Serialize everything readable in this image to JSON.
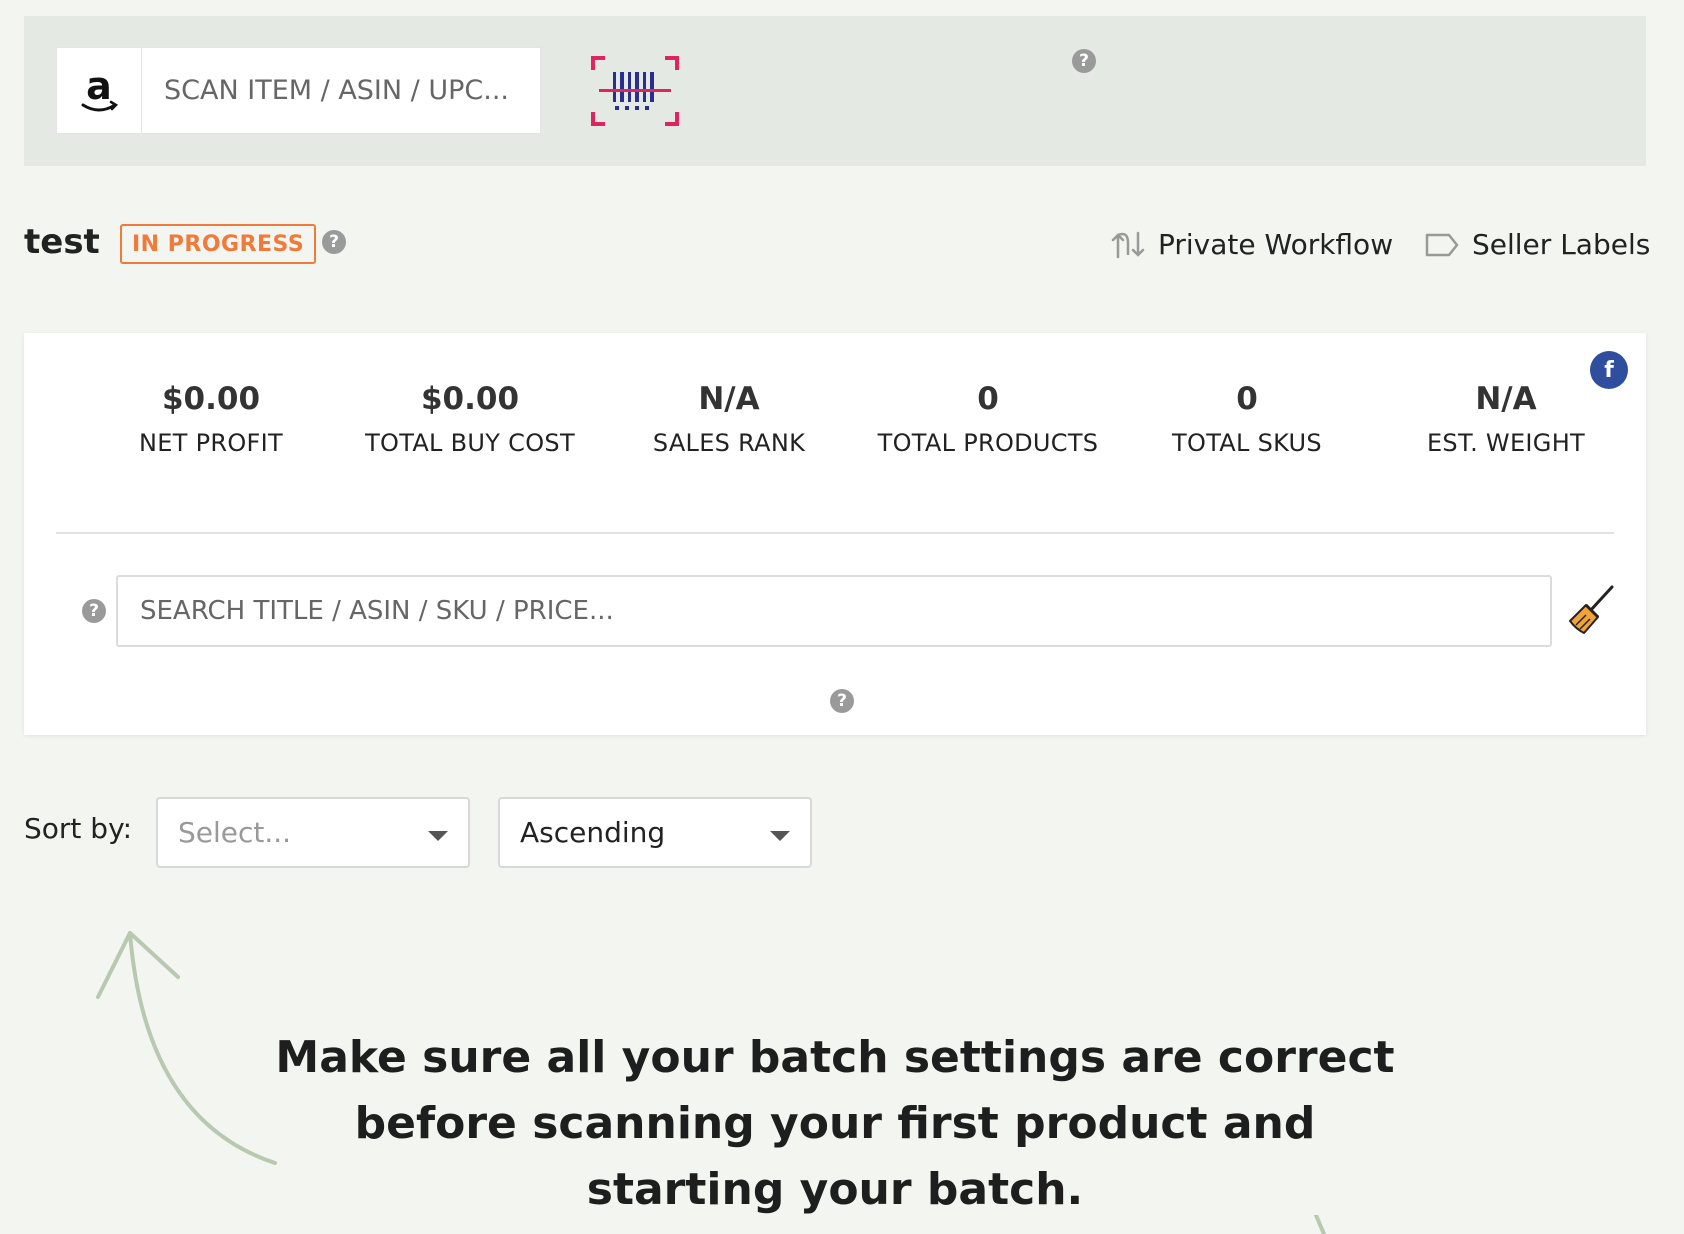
{
  "scan": {
    "placeholder": "SCAN ITEM / ASIN / UPC...",
    "icons": [
      "amazon-icon",
      "barcode-scanner-icon",
      "help-icon"
    ]
  },
  "batch": {
    "name": "test",
    "status": "IN PROGRESS",
    "links": {
      "workflow": "Private Workflow",
      "labels": "Seller Labels"
    }
  },
  "stats": [
    {
      "value": "$0.00",
      "label": "NET PROFIT"
    },
    {
      "value": "$0.00",
      "label": "TOTAL BUY COST"
    },
    {
      "value": "N/A",
      "label": "SALES RANK"
    },
    {
      "value": "0",
      "label": "TOTAL PRODUCTS"
    },
    {
      "value": "0",
      "label": "TOTAL SKUS"
    },
    {
      "value": "N/A",
      "label": "EST. WEIGHT"
    }
  ],
  "search": {
    "placeholder": "SEARCH TITLE / ASIN / SKU / PRICE..."
  },
  "sort": {
    "label": "Sort by:",
    "field_placeholder": "Select...",
    "order_value": "Ascending"
  },
  "hint": {
    "text": "Make sure all your batch settings are correct before scanning your first product and starting your batch."
  },
  "colors": {
    "accent_orange": "#f07a3a",
    "facebook_blue": "#2f4f9e",
    "page_bg": "#f2f5f0",
    "scan_bar_bg": "#e5e9e4",
    "arrow_green": "#b9c8b0"
  }
}
